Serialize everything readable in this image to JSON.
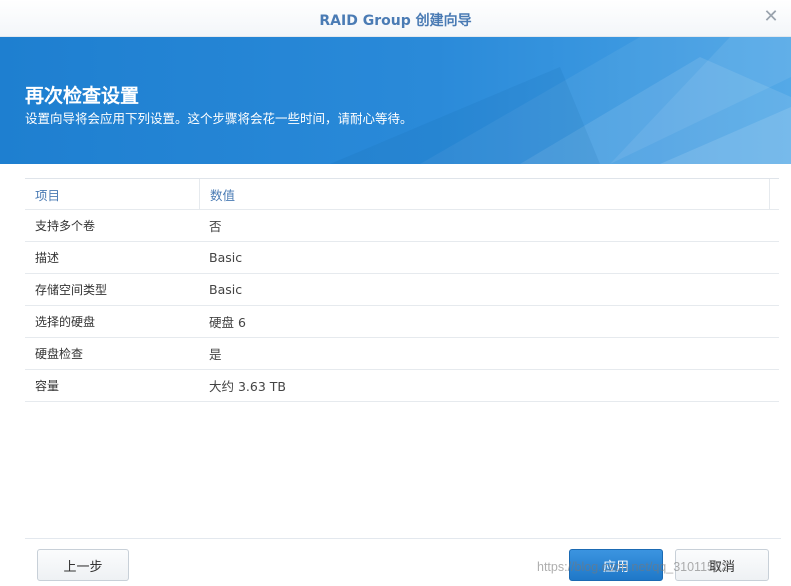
{
  "window": {
    "title": "RAID Group 创建向导",
    "close_glyph": "✕"
  },
  "banner": {
    "heading": "再次检查设置",
    "subheading": "设置向导将会应用下列设置。这个步骤将会花一些时间，请耐心等待。"
  },
  "table": {
    "columns": [
      "项目",
      "数值"
    ],
    "rows": [
      {
        "item": "支持多个卷",
        "value": "否"
      },
      {
        "item": "描述",
        "value": "Basic"
      },
      {
        "item": "存储空间类型",
        "value": "Basic"
      },
      {
        "item": "选择的硬盘",
        "value": "硬盘 6"
      },
      {
        "item": "硬盘检查",
        "value": "是"
      },
      {
        "item": "容量",
        "value": "大约 3.63 TB"
      }
    ]
  },
  "footer": {
    "prev_label": "上一步",
    "apply_label": "应用",
    "cancel_label": "取消"
  },
  "watermark": "https://blog.csdn.net/qq_31011582",
  "colors": {
    "accent": "#4a7bb4",
    "banner": "#2a8ad9",
    "primary_button": "#2a84d2"
  }
}
